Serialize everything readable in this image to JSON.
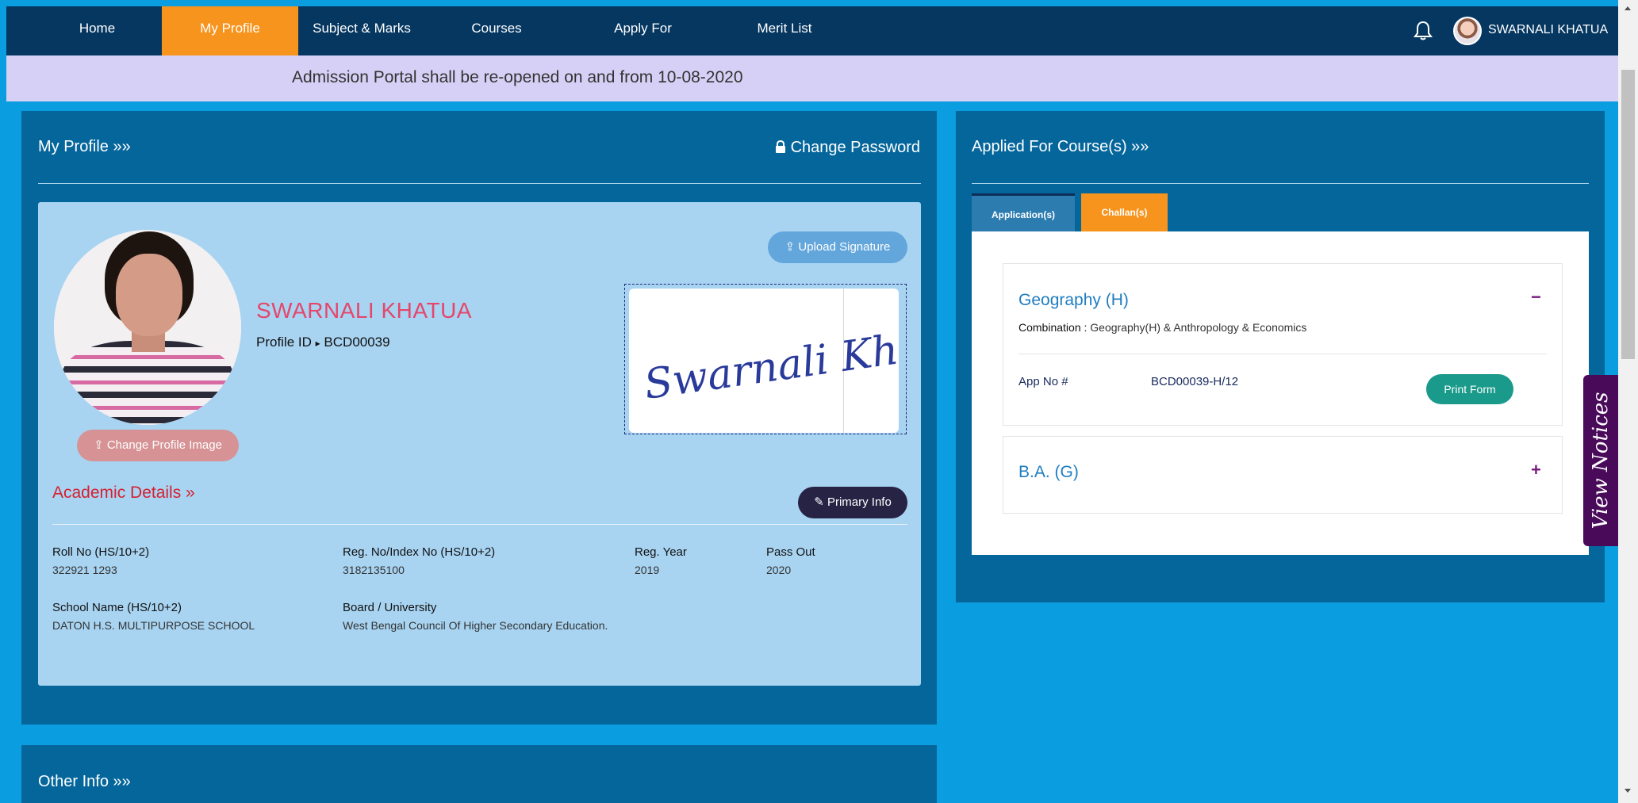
{
  "nav": {
    "items": [
      {
        "label": "Home",
        "active": false
      },
      {
        "label": "My Profile",
        "active": true
      },
      {
        "label": "Subject & Marks",
        "active": false
      },
      {
        "label": "Courses",
        "active": false
      },
      {
        "label": "Apply For",
        "active": false
      },
      {
        "label": "Merit List",
        "active": false
      }
    ],
    "user_name": "SWARNALI KHATUA",
    "icons": [
      "bell-icon",
      "chevron-down-icon"
    ]
  },
  "notice_banner": "Admission Portal shall be re-opened on and from 10-08-2020",
  "profile_panel": {
    "title": "My Profile »»",
    "change_password": "Change Password",
    "change_image_label": "Change Profile Image",
    "upload_signature_label": "Upload Signature",
    "student_name": "SWARNALI KHATUA",
    "profile_id_label": "Profile ID",
    "profile_id": "BCD00039",
    "signature_text": "Swarnali Khatua",
    "academic_title": "Academic Details »",
    "primary_info_label": "Primary Info",
    "fields": {
      "roll_no_label": "Roll No (HS/10+2)",
      "roll_no": "322921 1293",
      "reg_no_label": "Reg. No/Index No (HS/10+2)",
      "reg_no": "3182135100",
      "reg_year_label": "Reg. Year",
      "reg_year": "2019",
      "pass_out_label": "Pass Out",
      "pass_out": "2020",
      "school_label": "School Name (HS/10+2)",
      "school": "DATON H.S. MULTIPURPOSE SCHOOL",
      "board_label": "Board / University",
      "board": "West Bengal Council Of Higher Secondary Education."
    }
  },
  "applied_panel": {
    "title": "Applied For Course(s) »»",
    "tabs": [
      {
        "label": "Application(s)",
        "active": true
      },
      {
        "label": "Challan(s)",
        "active": false
      }
    ],
    "courses": [
      {
        "name": "Geography (H)",
        "toggle": "−",
        "combination_label": "Combination :",
        "combination": "Geography(H) & Anthropology & Economics",
        "app_no_label": "App No #",
        "app_no": "BCD00039-H/12",
        "print_label": "Print Form"
      },
      {
        "name": "B.A. (G)",
        "toggle": "+"
      }
    ]
  },
  "other_info_title": "Other Info »»",
  "view_notices_label": "View Notices",
  "colors": {
    "nav_bg": "#063761",
    "accent_orange": "#f7941d",
    "page_bg": "#0a9ddf",
    "panel_bg": "#05669c",
    "card_bg": "#a8d4f2",
    "notice_bg": "#d7d0f6",
    "name_pink": "#e6466c",
    "section_red": "#d62030",
    "course_blue": "#1f7dc1",
    "print_green": "#1a9a8a",
    "notices_purple": "#4a0a5a"
  }
}
